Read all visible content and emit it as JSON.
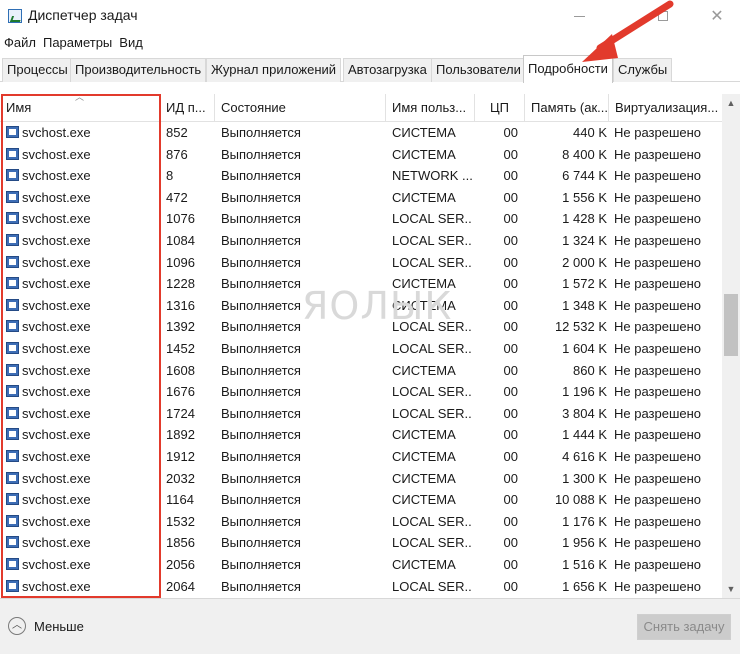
{
  "window": {
    "title": "Диспетчер задач"
  },
  "menu": [
    "Файл",
    "Параметры",
    "Вид"
  ],
  "tabs": [
    "Процессы",
    "Производительность",
    "Журнал приложений",
    "Автозагрузка",
    "Пользователи",
    "Подробности",
    "Службы"
  ],
  "active_tab": "Подробности",
  "columns": [
    "Имя",
    "ИД п...",
    "Состояние",
    "Имя польз...",
    "ЦП",
    "Память (ак...",
    "Виртуализация..."
  ],
  "rows": [
    {
      "name": "svchost.exe",
      "pid": "852",
      "status": "Выполняется",
      "user": "СИСТЕМА",
      "cpu": "00",
      "mem": "440 K",
      "virt": "Не разрешено"
    },
    {
      "name": "svchost.exe",
      "pid": "876",
      "status": "Выполняется",
      "user": "СИСТЕМА",
      "cpu": "00",
      "mem": "8 400 K",
      "virt": "Не разрешено"
    },
    {
      "name": "svchost.exe",
      "pid": "8",
      "status": "Выполняется",
      "user": "NETWORK ...",
      "cpu": "00",
      "mem": "6 744 K",
      "virt": "Не разрешено"
    },
    {
      "name": "svchost.exe",
      "pid": "472",
      "status": "Выполняется",
      "user": "СИСТЕМА",
      "cpu": "00",
      "mem": "1 556 K",
      "virt": "Не разрешено"
    },
    {
      "name": "svchost.exe",
      "pid": "1076",
      "status": "Выполняется",
      "user": "LOCAL SER...",
      "cpu": "00",
      "mem": "1 428 K",
      "virt": "Не разрешено"
    },
    {
      "name": "svchost.exe",
      "pid": "1084",
      "status": "Выполняется",
      "user": "LOCAL SER...",
      "cpu": "00",
      "mem": "1 324 K",
      "virt": "Не разрешено"
    },
    {
      "name": "svchost.exe",
      "pid": "1096",
      "status": "Выполняется",
      "user": "LOCAL SER...",
      "cpu": "00",
      "mem": "2 000 K",
      "virt": "Не разрешено"
    },
    {
      "name": "svchost.exe",
      "pid": "1228",
      "status": "Выполняется",
      "user": "СИСТЕМА",
      "cpu": "00",
      "mem": "1 572 K",
      "virt": "Не разрешено"
    },
    {
      "name": "svchost.exe",
      "pid": "1316",
      "status": "Выполняется",
      "user": "СИСТЕМА",
      "cpu": "00",
      "mem": "1 348 K",
      "virt": "Не разрешено"
    },
    {
      "name": "svchost.exe",
      "pid": "1392",
      "status": "Выполняется",
      "user": "LOCAL SER...",
      "cpu": "00",
      "mem": "12 532 K",
      "virt": "Не разрешено"
    },
    {
      "name": "svchost.exe",
      "pid": "1452",
      "status": "Выполняется",
      "user": "LOCAL SER...",
      "cpu": "00",
      "mem": "1 604 K",
      "virt": "Не разрешено"
    },
    {
      "name": "svchost.exe",
      "pid": "1608",
      "status": "Выполняется",
      "user": "СИСТЕМА",
      "cpu": "00",
      "mem": "860 K",
      "virt": "Не разрешено"
    },
    {
      "name": "svchost.exe",
      "pid": "1676",
      "status": "Выполняется",
      "user": "LOCAL SER...",
      "cpu": "00",
      "mem": "1 196 K",
      "virt": "Не разрешено"
    },
    {
      "name": "svchost.exe",
      "pid": "1724",
      "status": "Выполняется",
      "user": "LOCAL SER...",
      "cpu": "00",
      "mem": "3 804 K",
      "virt": "Не разрешено"
    },
    {
      "name": "svchost.exe",
      "pid": "1892",
      "status": "Выполняется",
      "user": "СИСТЕМА",
      "cpu": "00",
      "mem": "1 444 K",
      "virt": "Не разрешено"
    },
    {
      "name": "svchost.exe",
      "pid": "1912",
      "status": "Выполняется",
      "user": "СИСТЕМА",
      "cpu": "00",
      "mem": "4 616 K",
      "virt": "Не разрешено"
    },
    {
      "name": "svchost.exe",
      "pid": "2032",
      "status": "Выполняется",
      "user": "СИСТЕМА",
      "cpu": "00",
      "mem": "1 300 K",
      "virt": "Не разрешено"
    },
    {
      "name": "svchost.exe",
      "pid": "1164",
      "status": "Выполняется",
      "user": "СИСТЕМА",
      "cpu": "00",
      "mem": "10 088 K",
      "virt": "Не разрешено"
    },
    {
      "name": "svchost.exe",
      "pid": "1532",
      "status": "Выполняется",
      "user": "LOCAL SER...",
      "cpu": "00",
      "mem": "1 176 K",
      "virt": "Не разрешено"
    },
    {
      "name": "svchost.exe",
      "pid": "1856",
      "status": "Выполняется",
      "user": "LOCAL SER...",
      "cpu": "00",
      "mem": "1 956 K",
      "virt": "Не разрешено"
    },
    {
      "name": "svchost.exe",
      "pid": "2056",
      "status": "Выполняется",
      "user": "СИСТЕМА",
      "cpu": "00",
      "mem": "1 516 K",
      "virt": "Не разрешено"
    },
    {
      "name": "svchost.exe",
      "pid": "2064",
      "status": "Выполняется",
      "user": "LOCAL SER...",
      "cpu": "00",
      "mem": "1 656 K",
      "virt": "Не разрешено"
    }
  ],
  "watermark": "ЯОЛЫК",
  "footer": {
    "less_label": "Меньше",
    "end_task_label": "Снять задачу"
  },
  "colors": {
    "highlight": "#e23a2c",
    "accent_icon": "#3d6db5"
  }
}
